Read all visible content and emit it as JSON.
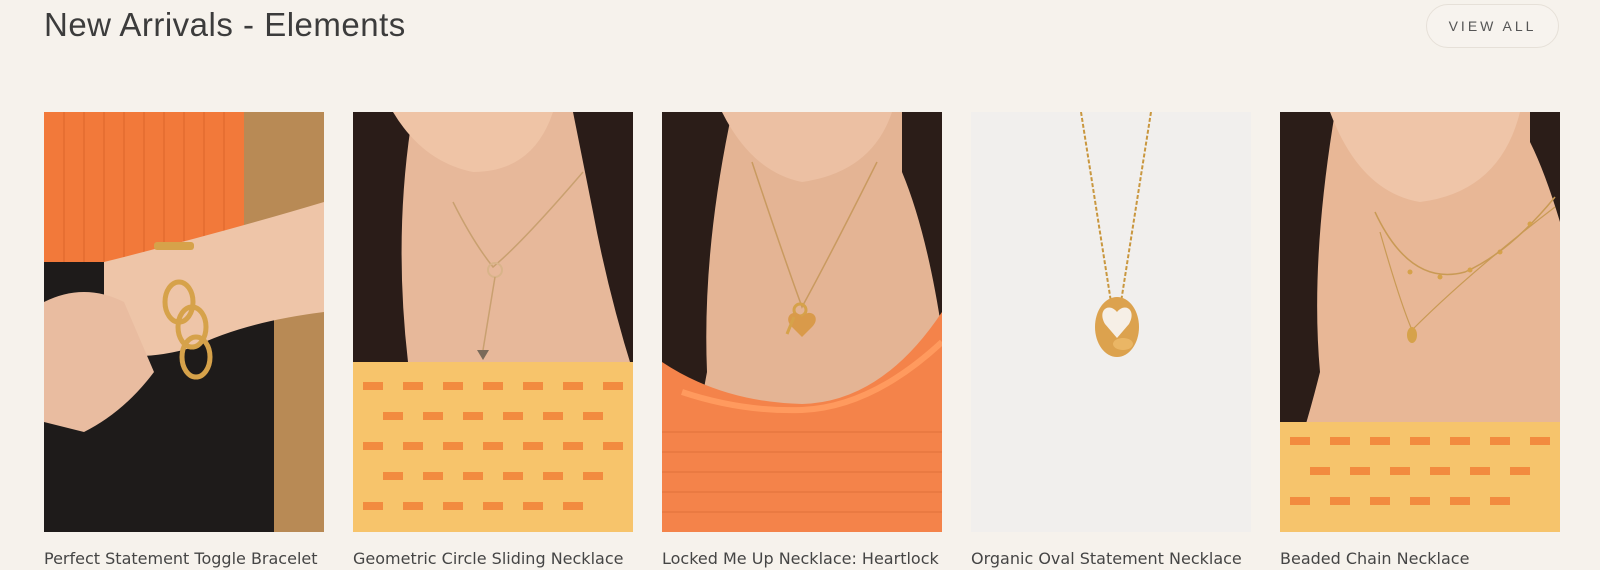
{
  "header": {
    "title": "New Arrivals - Elements",
    "view_all_label": "VIEW ALL"
  },
  "products": [
    {
      "title": "Perfect Statement Toggle Bracelet",
      "image": "bracelet-on-wrist"
    },
    {
      "title": "Geometric Circle Sliding Necklace",
      "image": "lariat-necklace-model"
    },
    {
      "title": "Locked Me Up Necklace: Heartlock",
      "image": "heartlock-necklace-model"
    },
    {
      "title": "Organic Oval Statement Necklace",
      "image": "oval-pendant-product"
    },
    {
      "title": "Beaded Chain Necklace",
      "image": "layered-chain-model"
    }
  ],
  "colors": {
    "background": "#f6f2ec",
    "accent_orange": "#f07d3a",
    "gold": "#d6a24a"
  }
}
